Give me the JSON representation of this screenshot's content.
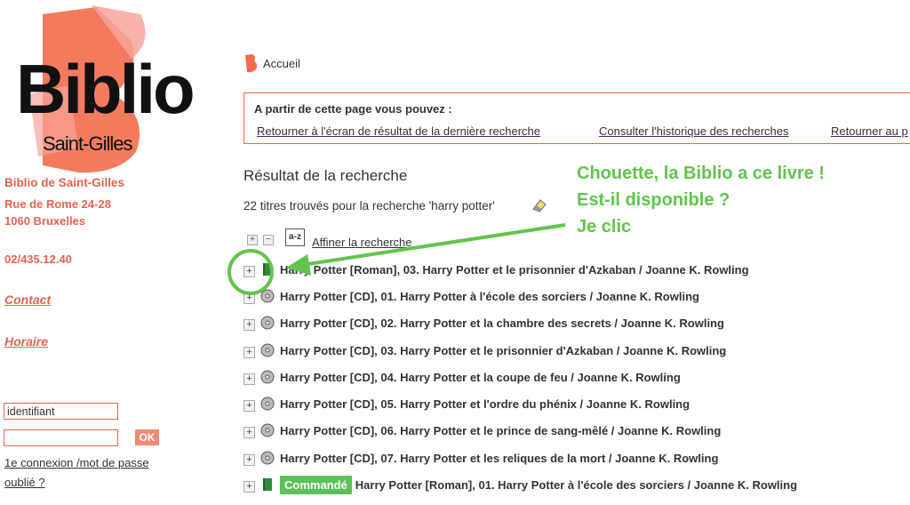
{
  "sidebar": {
    "logo_text": "Biblio",
    "logo_sub": "Saint-Gilles",
    "library_name": "Biblio de Saint-Gilles",
    "address_line1": "Rue de Rome 24-28",
    "address_line2": "1060 Bruxelles",
    "phone": "02/435.12.40",
    "contact_label": "Contact",
    "hours_label": "Horaire",
    "username_value": "identifiant",
    "password_value": "",
    "ok_label": "OK",
    "forgot_label": "1e connexion /mot de passe oublié ?"
  },
  "breadcrumb": {
    "home_label": "Accueil"
  },
  "infobox": {
    "heading": "A partir de cette page vous pouvez :",
    "links": [
      "Retourner à l'écran de résultat de la dernière recherche",
      "Consulter l'historique des recherches",
      "Retourner au p"
    ]
  },
  "results": {
    "title": "Résultat de la recherche",
    "count_text": "22 titres trouvés pour la recherche 'harry potter'",
    "sort_icon_label": "a-z",
    "refine_label": "Affiner la recherche",
    "items": [
      {
        "text": "Harry Potter [Roman], 03. Harry Potter et le prisonnier d'Azkaban / Joanne K. Rowling",
        "media": "book-icon"
      },
      {
        "text": "Harry Potter [CD], 01. Harry Potter à l'école des sorciers / Joanne K. Rowling",
        "media": "cd-icon"
      },
      {
        "text": "Harry Potter [CD], 02. Harry Potter et la chambre des secrets / Joanne K. Rowling",
        "media": "cd-icon"
      },
      {
        "text": "Harry Potter [CD], 03. Harry Potter et le prisonnier d'Azkaban / Joanne K. Rowling",
        "media": "cd-icon"
      },
      {
        "text": "Harry Potter [CD], 04. Harry Potter et la coupe de feu / Joanne K. Rowling",
        "media": "cd-icon"
      },
      {
        "text": "Harry Potter [CD], 05. Harry Potter et l'ordre du phénix / Joanne K. Rowling",
        "media": "cd-icon"
      },
      {
        "text": "Harry Potter [CD], 06. Harry Potter et le prince de sang-mêlé / Joanne K. Rowling",
        "media": "cd-icon"
      },
      {
        "text": "Harry Potter [CD], 07. Harry Potter et les reliques de la mort / Joanne K. Rowling",
        "media": "cd-icon"
      },
      {
        "text": "Harry Potter [Roman], 01. Harry Potter à l'école des sorciers / Joanne K. Rowling",
        "media": "book-icon",
        "badge": "Commandé"
      }
    ]
  },
  "annotation": {
    "line1": "Chouette, la Biblio a ce livre !",
    "line2": "Est-il disponible ?",
    "line3": "Je clic",
    "color": "#62c44d"
  },
  "colors": {
    "accent": "#e8634e",
    "badge_green": "#5cc15a"
  }
}
